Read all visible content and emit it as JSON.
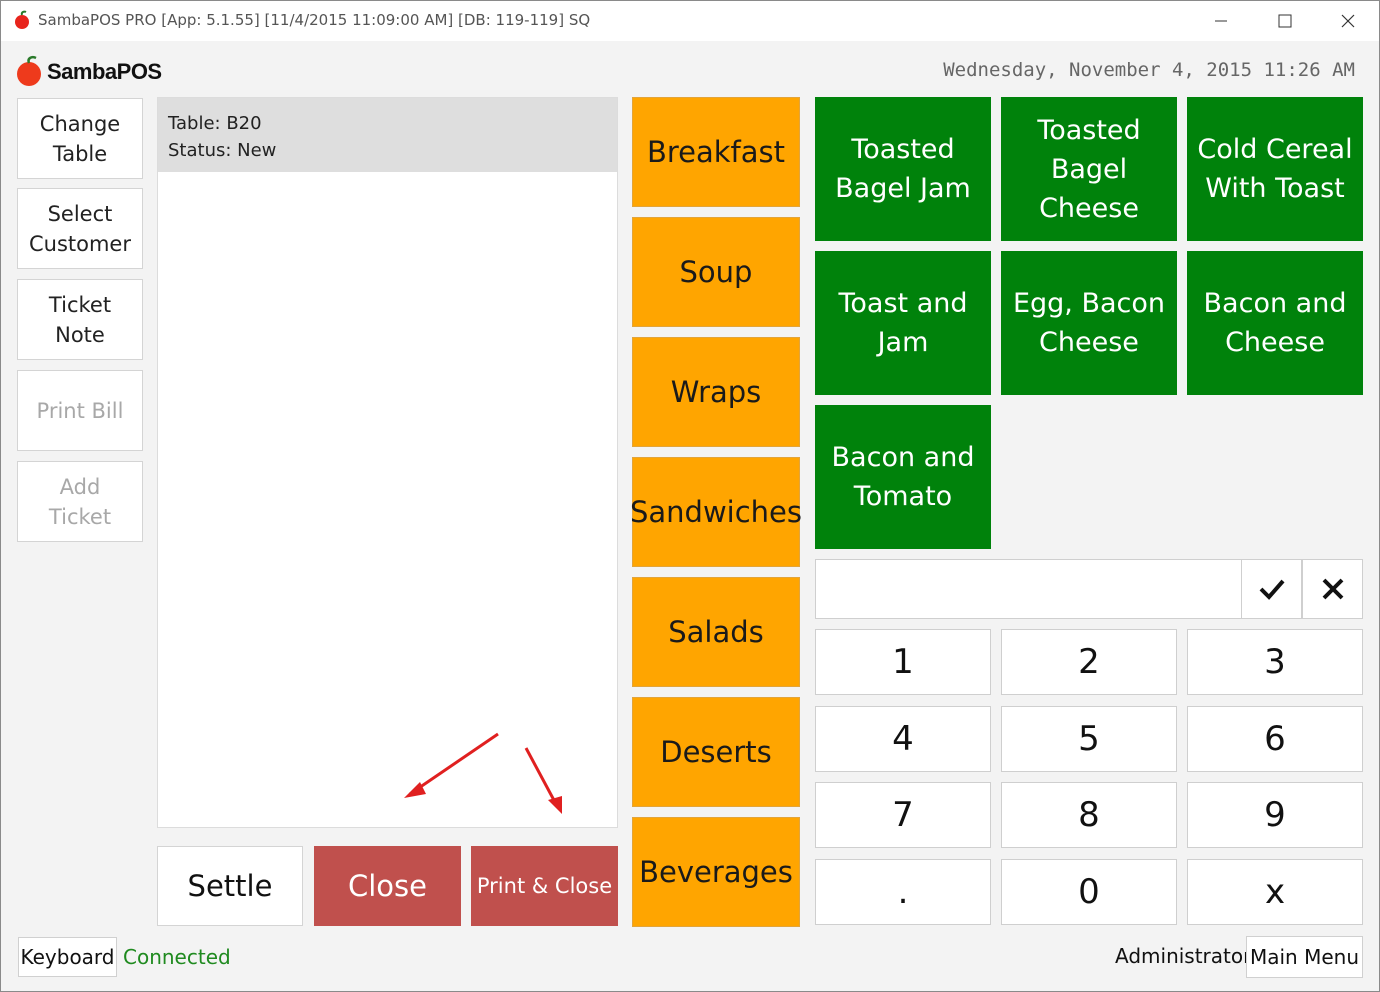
{
  "window": {
    "title": "SambaPOS PRO [App: 5.1.55] [11/4/2015 11:09:00 AM] [DB: 119-119] SQ"
  },
  "header": {
    "logo_text": "SambaPOS",
    "datetime": "Wednesday, November 4, 2015 11:26 AM"
  },
  "commands": [
    {
      "label": "Change\nTable",
      "enabled": true
    },
    {
      "label": "Select\nCustomer",
      "enabled": true
    },
    {
      "label": "Ticket\nNote",
      "enabled": true
    },
    {
      "label": "Print Bill",
      "enabled": false
    },
    {
      "label": "Add\nTicket",
      "enabled": false
    }
  ],
  "ticket": {
    "table_line": "Table: B20",
    "status_line": "Status: New"
  },
  "actions": {
    "settle": "Settle",
    "close": "Close",
    "print_close": "Print & Close"
  },
  "categories": [
    "Breakfast",
    "Soup",
    "Wraps",
    "Sandwiches",
    "Salads",
    "Deserts",
    "Beverages"
  ],
  "products": [
    "Toasted\nBagel Jam",
    "Toasted\nBagel Cheese",
    "Cold Cereal\nWith Toast",
    "Toast and\nJam",
    "Egg, Bacon\nCheese",
    "Bacon and\nCheese",
    "Bacon and\nTomato"
  ],
  "numpad": {
    "input_value": "",
    "keys": [
      "1",
      "2",
      "3",
      "4",
      "5",
      "6",
      "7",
      "8",
      "9",
      ".",
      "0",
      "x"
    ]
  },
  "statusbar": {
    "keyboard": "Keyboard",
    "connection": "Connected",
    "user": "Administrator",
    "main_menu": "Main Menu"
  },
  "colors": {
    "category": "#ffa500",
    "product": "#00820b",
    "action_red": "#c0504d",
    "connected": "#1f8a1f"
  },
  "icons": [
    "app-icon",
    "minimize-icon",
    "maximize-icon",
    "close-icon",
    "checkmark-icon",
    "cancel-x-icon"
  ]
}
